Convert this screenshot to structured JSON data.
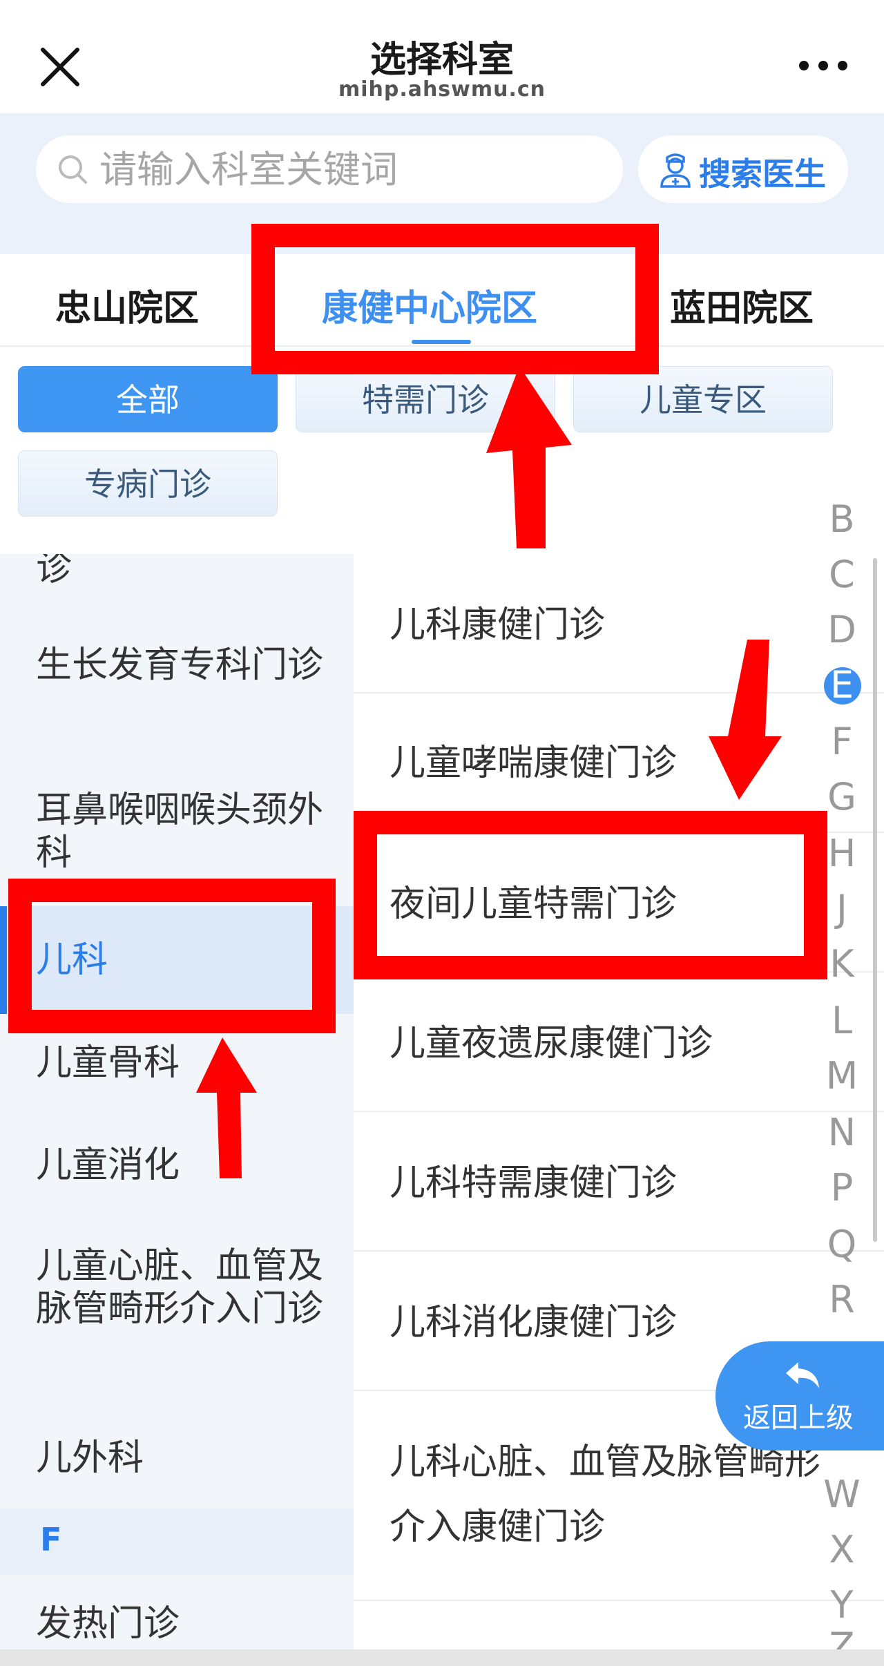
{
  "header": {
    "title": "选择科室",
    "domain": "mihp.ahswmu.cn"
  },
  "search": {
    "placeholder": "请输入科室关键词",
    "doctor_button": "搜索医生"
  },
  "campus_tabs": [
    {
      "label": "忠山院区",
      "active": false
    },
    {
      "label": "康健中心院区",
      "active": true
    },
    {
      "label": "蓝田院区",
      "active": false
    }
  ],
  "filter_chips": [
    {
      "label": "全部",
      "active": true
    },
    {
      "label": "特需门诊",
      "active": false
    },
    {
      "label": "儿童专区",
      "active": false
    },
    {
      "label": "专病门诊",
      "active": false
    }
  ],
  "categories": {
    "partial_top": "诊",
    "items": [
      {
        "label": "生长发育专科门诊",
        "active": false
      },
      {
        "label": "耳鼻喉咽喉头颈外科",
        "active": false
      },
      {
        "label": "儿科",
        "active": true
      },
      {
        "label": "儿童骨科",
        "active": false
      },
      {
        "label": "儿童消化",
        "active": false
      },
      {
        "label": "儿童心脏、血管及脉管畸形介入门诊",
        "active": false
      },
      {
        "label": "儿外科",
        "active": false
      }
    ],
    "section_letter": "F",
    "after_section": "发热门诊"
  },
  "departments": [
    "儿科康健门诊",
    "儿童哮喘康健门诊",
    "夜间儿童特需门诊",
    "儿童夜遗尿康健门诊",
    "儿科特需康健门诊",
    "儿科消化康健门诊",
    "儿科心脏、血管及脉管畸形介入康健门诊"
  ],
  "index_letters": [
    "B",
    "C",
    "D",
    "E",
    "F",
    "G",
    "H",
    "J",
    "K",
    "L",
    "M",
    "N",
    "P",
    "Q",
    "R",
    "W",
    "X",
    "Y",
    "Z"
  ],
  "index_active": "E",
  "back_button": {
    "label": "返回上级"
  },
  "colors": {
    "accent": "#3d8ff0",
    "highlight": "#ff0000"
  }
}
